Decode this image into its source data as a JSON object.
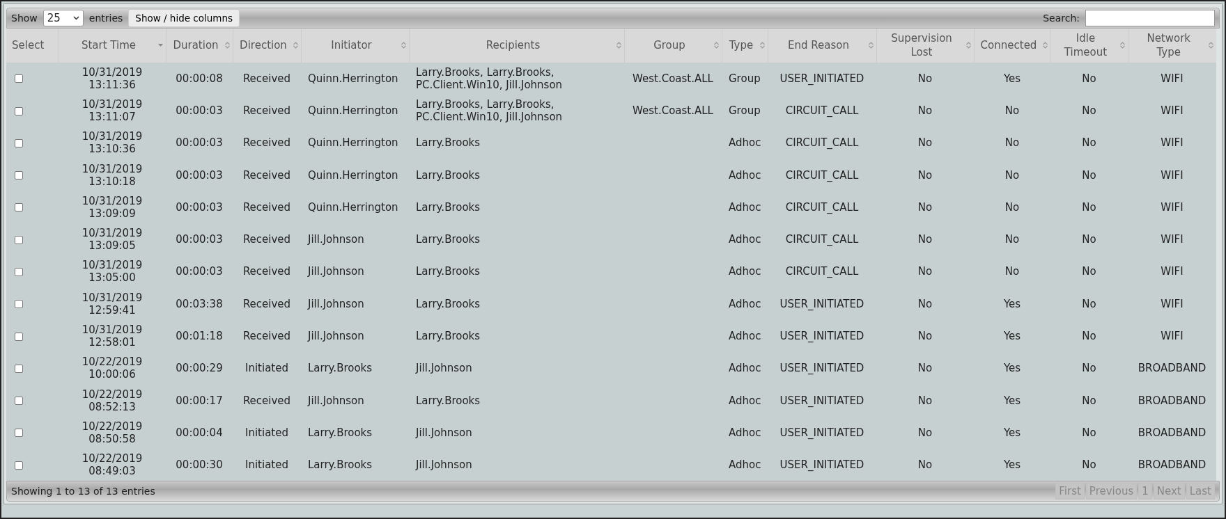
{
  "toolbar": {
    "show_label": "Show",
    "page_size": "25",
    "entries_label": "entries",
    "columns_button": "Show / hide columns",
    "search_label": "Search:"
  },
  "table": {
    "columns": [
      {
        "label": "Select",
        "sortable": false
      },
      {
        "label": "Start Time",
        "sortable": true,
        "sorted": true
      },
      {
        "label": "Duration",
        "sortable": true,
        "sorted": false
      },
      {
        "label": "Direction",
        "sortable": true,
        "sorted": false
      },
      {
        "label": "Initiator",
        "sortable": true,
        "sorted": false
      },
      {
        "label": "Recipients",
        "sortable": true,
        "sorted": false
      },
      {
        "label": "Group",
        "sortable": true,
        "sorted": false
      },
      {
        "label": "Type",
        "sortable": true,
        "sorted": false
      },
      {
        "label": "End Reason",
        "sortable": true,
        "sorted": false
      },
      {
        "label": "Supervision Lost",
        "sortable": true,
        "sorted": false
      },
      {
        "label": "Connected",
        "sortable": true,
        "sorted": false
      },
      {
        "label": "Idle Timeout",
        "sortable": true,
        "sorted": false
      },
      {
        "label": "Network Type",
        "sortable": true,
        "sorted": false
      }
    ],
    "rows": [
      {
        "selected": false,
        "cells": [
          "",
          "10/31/2019 13:11:36",
          "00:00:08",
          "Received",
          "Quinn.Herrington",
          "Larry.Brooks, Larry.Brooks, PC.Client.Win10, Jill.Johnson",
          "West.Coast.ALL",
          "Group",
          "USER_INITIATED",
          "No",
          "Yes",
          "No",
          "WIFI"
        ]
      },
      {
        "selected": false,
        "cells": [
          "",
          "10/31/2019 13:11:07",
          "00:00:03",
          "Received",
          "Quinn.Herrington",
          "Larry.Brooks, Larry.Brooks, PC.Client.Win10, Jill.Johnson",
          "West.Coast.ALL",
          "Group",
          "CIRCUIT_CALL",
          "No",
          "No",
          "No",
          "WIFI"
        ]
      },
      {
        "selected": false,
        "cells": [
          "",
          "10/31/2019 13:10:36",
          "00:00:03",
          "Received",
          "Quinn.Herrington",
          "Larry.Brooks",
          "",
          "Adhoc",
          "CIRCUIT_CALL",
          "No",
          "No",
          "No",
          "WIFI"
        ]
      },
      {
        "selected": false,
        "cells": [
          "",
          "10/31/2019 13:10:18",
          "00:00:03",
          "Received",
          "Quinn.Herrington",
          "Larry.Brooks",
          "",
          "Adhoc",
          "CIRCUIT_CALL",
          "No",
          "No",
          "No",
          "WIFI"
        ]
      },
      {
        "selected": false,
        "cells": [
          "",
          "10/31/2019 13:09:09",
          "00:00:03",
          "Received",
          "Quinn.Herrington",
          "Larry.Brooks",
          "",
          "Adhoc",
          "CIRCUIT_CALL",
          "No",
          "No",
          "No",
          "WIFI"
        ]
      },
      {
        "selected": false,
        "cells": [
          "",
          "10/31/2019 13:09:05",
          "00:00:03",
          "Received",
          "Jill.Johnson",
          "Larry.Brooks",
          "",
          "Adhoc",
          "CIRCUIT_CALL",
          "No",
          "No",
          "No",
          "WIFI"
        ]
      },
      {
        "selected": false,
        "cells": [
          "",
          "10/31/2019 13:05:00",
          "00:00:03",
          "Received",
          "Jill.Johnson",
          "Larry.Brooks",
          "",
          "Adhoc",
          "CIRCUIT_CALL",
          "No",
          "No",
          "No",
          "WIFI"
        ]
      },
      {
        "selected": false,
        "cells": [
          "",
          "10/31/2019 12:59:41",
          "00:03:38",
          "Received",
          "Jill.Johnson",
          "Larry.Brooks",
          "",
          "Adhoc",
          "USER_INITIATED",
          "No",
          "Yes",
          "No",
          "WIFI"
        ]
      },
      {
        "selected": false,
        "cells": [
          "",
          "10/31/2019 12:58:01",
          "00:01:18",
          "Received",
          "Jill.Johnson",
          "Larry.Brooks",
          "",
          "Adhoc",
          "USER_INITIATED",
          "No",
          "Yes",
          "No",
          "WIFI"
        ]
      },
      {
        "selected": false,
        "cells": [
          "",
          "10/22/2019 10:00:06",
          "00:00:29",
          "Initiated",
          "Larry.Brooks",
          "Jill.Johnson",
          "",
          "Adhoc",
          "USER_INITIATED",
          "No",
          "Yes",
          "No",
          "BROADBAND"
        ]
      },
      {
        "selected": false,
        "cells": [
          "",
          "10/22/2019 08:52:13",
          "00:00:17",
          "Received",
          "Jill.Johnson",
          "Larry.Brooks",
          "",
          "Adhoc",
          "USER_INITIATED",
          "No",
          "Yes",
          "No",
          "BROADBAND"
        ]
      },
      {
        "selected": false,
        "cells": [
          "",
          "10/22/2019 08:50:58",
          "00:00:04",
          "Initiated",
          "Larry.Brooks",
          "Jill.Johnson",
          "",
          "Adhoc",
          "USER_INITIATED",
          "No",
          "Yes",
          "No",
          "BROADBAND"
        ]
      },
      {
        "selected": false,
        "cells": [
          "",
          "10/22/2019 08:49:03",
          "00:00:30",
          "Initiated",
          "Larry.Brooks",
          "Jill.Johnson",
          "",
          "Adhoc",
          "USER_INITIATED",
          "No",
          "Yes",
          "No",
          "BROADBAND"
        ]
      }
    ]
  },
  "footer": {
    "info": "Showing 1 to 13 of 13 entries",
    "pager": [
      {
        "label": "First",
        "disabled": true
      },
      {
        "label": "Previous",
        "disabled": true
      },
      {
        "label": "1",
        "disabled": true
      },
      {
        "label": "Next",
        "disabled": true
      },
      {
        "label": "Last",
        "disabled": true
      }
    ]
  }
}
